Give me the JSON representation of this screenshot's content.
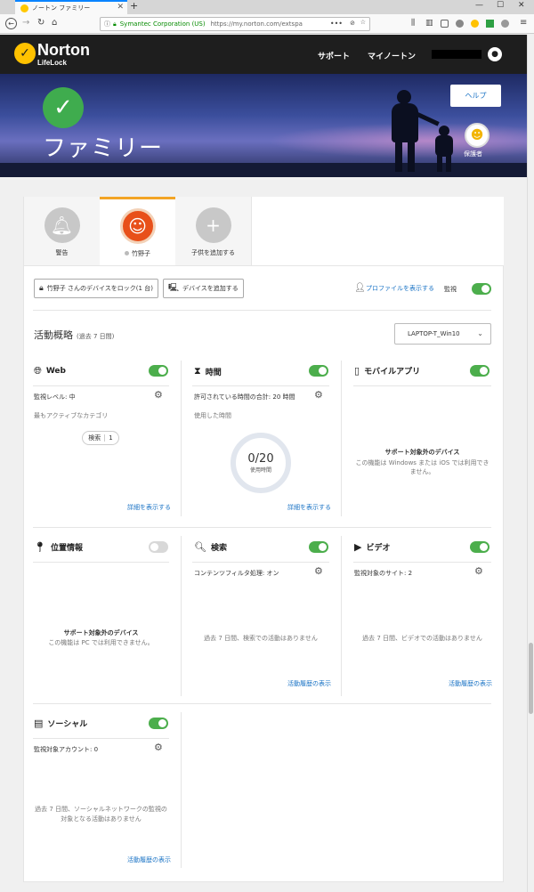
{
  "browser": {
    "tab_title": "ノートン ファミリー",
    "new_tab": "+",
    "url_security": "Symantec Corporation (US)",
    "url": "https://my.norton.com/extspa",
    "url_dots": "•••",
    "win_min": "—",
    "win_max": "☐",
    "win_close": "✕",
    "tab_close": "✕"
  },
  "header": {
    "brand": "Norton",
    "sub_brand": "LifeLock",
    "nav_support": "サポート",
    "nav_mynorton": "マイノートン"
  },
  "banner": {
    "title": "ファミリー",
    "help_button": "ヘルプ",
    "parent_label": "保護者"
  },
  "profile_tabs": [
    {
      "label": "警告"
    },
    {
      "label": "竹野子"
    },
    {
      "label": "子供を追加する"
    }
  ],
  "toolbar": {
    "lock_label": "竹野子 さんのデバイスをロック(1 台)",
    "add_device_label": "デバイスを追加する",
    "show_profile_label": "プロファイルを表示する",
    "monitor_label": "監視",
    "monitor_on": true
  },
  "activity": {
    "title": "活動概略",
    "subtitle": "(過去 7 日間)",
    "device": "LAPTOP-T_Win10"
  },
  "panels": {
    "web": {
      "title": "Web",
      "enabled": true,
      "level_label": "監視レベル: 中",
      "top_category_label": "最もアクティブなカテゴリ",
      "category_name": "検索",
      "category_count": "1",
      "details_link": "詳細を表示する"
    },
    "time": {
      "title": "時間",
      "enabled": true,
      "allowed_label": "許可されている時間の合計: 20 時間",
      "used_label": "使用した時間",
      "usage_value": "0/20",
      "usage_unit": "使用時間",
      "details_link": "詳細を表示する"
    },
    "mobile": {
      "title": "モバイルアプリ",
      "enabled": true,
      "unsupported_title": "サポート対象外のデバイス",
      "unsupported_text": "この機能は Windows または iOS では利用できません。"
    },
    "location": {
      "title": "位置情報",
      "enabled": false,
      "unsupported_title": "サポート対象外のデバイス",
      "unsupported_text": "この機能は PC では利用できません。"
    },
    "search": {
      "title": "検索",
      "enabled": true,
      "filter_label": "コンテンツフィルタ処理: オン",
      "empty_text": "過去 7 日間、検索での活動はありません",
      "history_link": "活動履歴の表示"
    },
    "video": {
      "title": "ビデオ",
      "enabled": true,
      "sites_label": "監視対象のサイト: 2",
      "empty_text": "過去 7 日間、ビデオでの活動はありません",
      "history_link": "活動履歴の表示"
    },
    "social": {
      "title": "ソーシャル",
      "enabled": true,
      "accounts_label": "監視対象アカウント: 0",
      "empty_text": "過去 7 日間、ソーシャルネットワークの監視の対象となる活動はありません",
      "history_link": "活動履歴の表示"
    }
  },
  "colors": {
    "accent_green": "#4cae4c",
    "link_blue": "#1a73c5",
    "tab_accent": "#f3a425",
    "brand_yellow": "#ffc200"
  }
}
